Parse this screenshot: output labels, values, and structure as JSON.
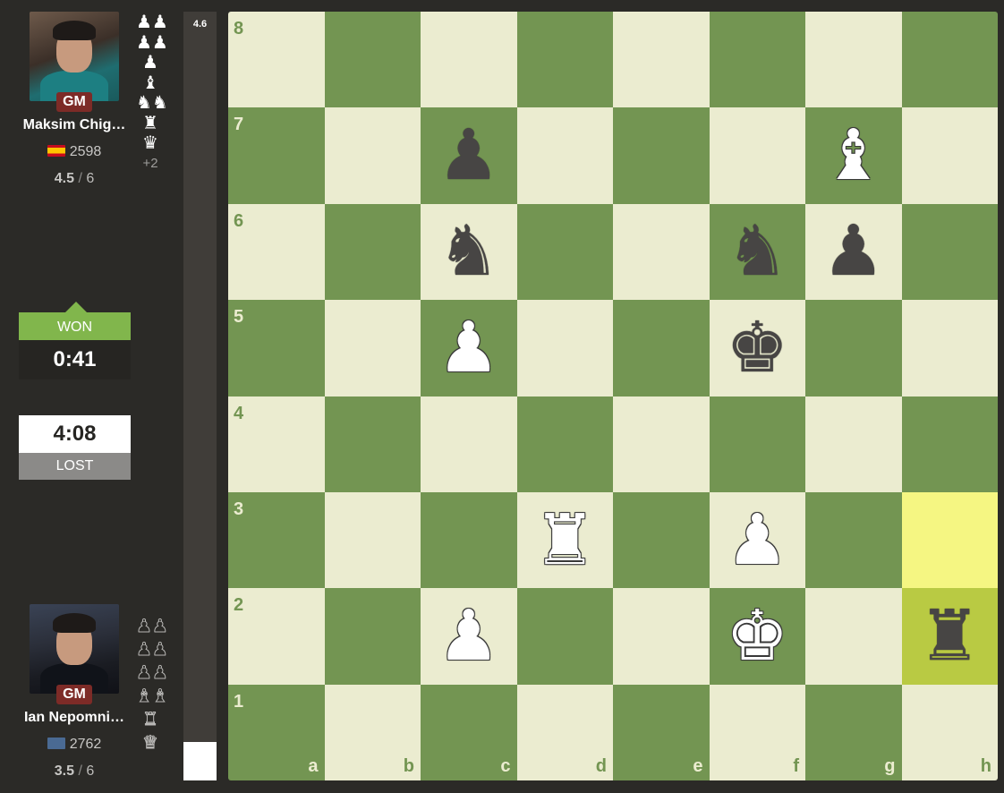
{
  "top_player": {
    "title": "GM",
    "name": "Maksim Chig…",
    "flag": "es",
    "rating": "2598",
    "score_points": "4.5",
    "score_total": "6"
  },
  "top_captured": {
    "pieces": [
      "♟♟",
      "♟♟",
      "♟",
      "♝",
      "♞♞",
      "♜",
      "♛"
    ],
    "more": "+2"
  },
  "bottom_player": {
    "title": "GM",
    "name": "Ian Nepomni…",
    "flag": "generic",
    "rating": "2762",
    "score_points": "3.5",
    "score_total": "6"
  },
  "bottom_captured": {
    "pieces": [
      "♟♟",
      "♟♟",
      "♟♟",
      "♝♝",
      "♜",
      "♛"
    ]
  },
  "result": {
    "top_label": "WON",
    "top_time": "0:41",
    "bottom_time": "4:08",
    "bottom_label": "LOST"
  },
  "eval": {
    "text": "4.6",
    "white_fraction": 0.05
  },
  "board": {
    "ranks": [
      "8",
      "7",
      "6",
      "5",
      "4",
      "3",
      "2",
      "1"
    ],
    "files": [
      "a",
      "b",
      "c",
      "d",
      "e",
      "f",
      "g",
      "h"
    ],
    "highlighted": [
      "h3",
      "h2"
    ],
    "pieces": [
      {
        "square": "c7",
        "color": "b",
        "glyph": "♟",
        "name": "black-pawn"
      },
      {
        "square": "g7",
        "color": "w",
        "glyph": "♝",
        "name": "white-bishop"
      },
      {
        "square": "c6",
        "color": "b",
        "glyph": "♞",
        "name": "black-knight"
      },
      {
        "square": "f6",
        "color": "b",
        "glyph": "♞",
        "name": "black-knight"
      },
      {
        "square": "g6",
        "color": "b",
        "glyph": "♟",
        "name": "black-pawn"
      },
      {
        "square": "c5",
        "color": "w",
        "glyph": "♟",
        "name": "white-pawn"
      },
      {
        "square": "f5",
        "color": "b",
        "glyph": "♚",
        "name": "black-king"
      },
      {
        "square": "d3",
        "color": "w",
        "glyph": "♜",
        "name": "white-rook"
      },
      {
        "square": "f3",
        "color": "w",
        "glyph": "♟",
        "name": "white-pawn"
      },
      {
        "square": "c2",
        "color": "w",
        "glyph": "♟",
        "name": "white-pawn"
      },
      {
        "square": "f2",
        "color": "w",
        "glyph": "♚",
        "name": "white-king"
      },
      {
        "square": "h2",
        "color": "b",
        "glyph": "♜",
        "name": "black-rook"
      }
    ]
  }
}
